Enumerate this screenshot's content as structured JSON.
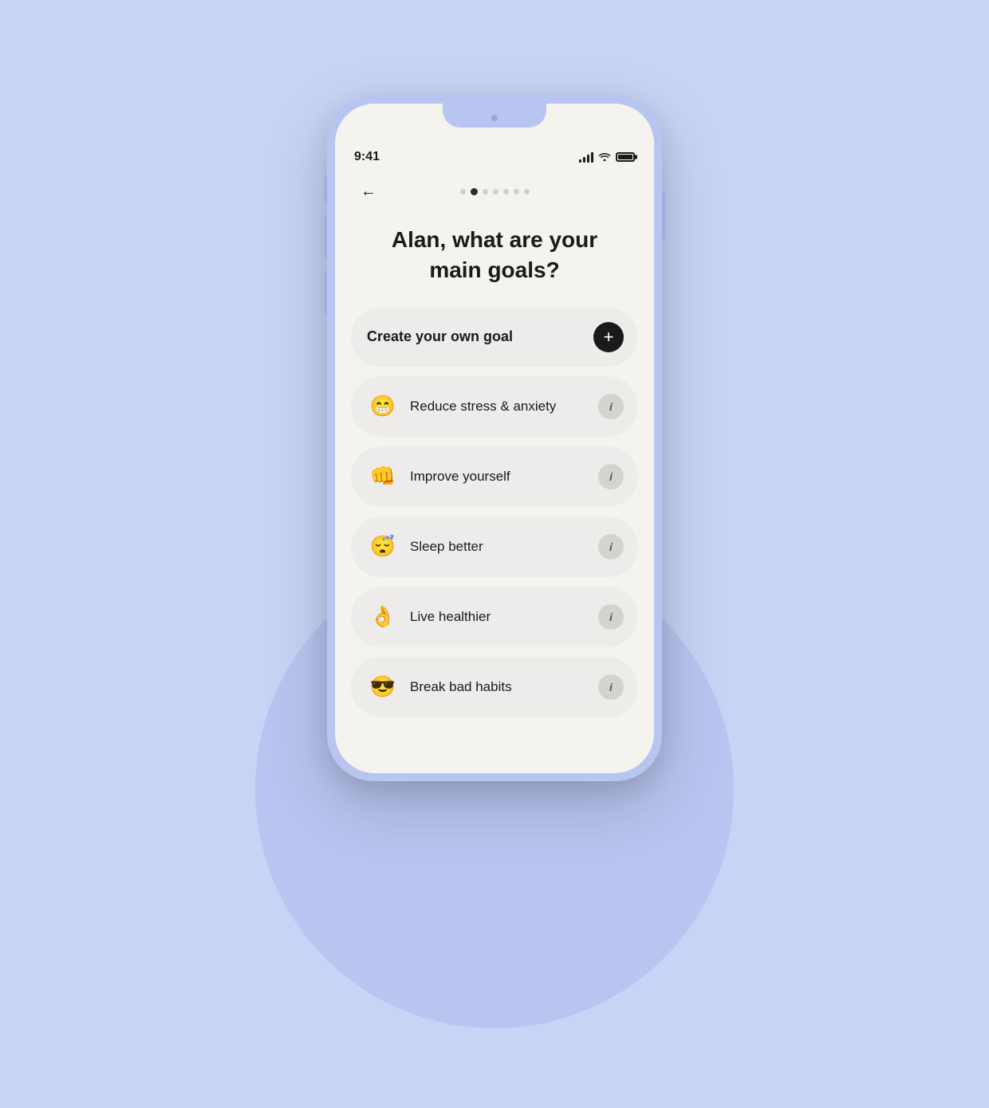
{
  "background": {
    "color": "#c8d3f5"
  },
  "statusBar": {
    "time": "9:41",
    "batteryFull": true
  },
  "navigation": {
    "backLabel": "←",
    "dots": [
      {
        "id": 1,
        "active": false
      },
      {
        "id": 2,
        "active": true
      },
      {
        "id": 3,
        "active": false
      },
      {
        "id": 4,
        "active": false
      },
      {
        "id": 5,
        "active": false
      },
      {
        "id": 6,
        "active": false
      },
      {
        "id": 7,
        "active": false
      }
    ]
  },
  "page": {
    "title": "Alan, what are your\nmain goals?"
  },
  "goals": [
    {
      "id": "create-own",
      "label": "Create your own goal",
      "emoji": null,
      "action": "add",
      "bold": true
    },
    {
      "id": "reduce-stress",
      "label": "Reduce stress & anxiety",
      "emoji": "😁",
      "action": "info"
    },
    {
      "id": "improve-yourself",
      "label": "Improve yourself",
      "emoji": "👊",
      "action": "info"
    },
    {
      "id": "sleep-better",
      "label": "Sleep better",
      "emoji": "😴",
      "action": "info"
    },
    {
      "id": "live-healthier",
      "label": "Live healthier",
      "emoji": "👌",
      "action": "info"
    },
    {
      "id": "break-bad-habits",
      "label": "Break bad habits",
      "emoji": "😎",
      "action": "info"
    }
  ],
  "infoButtonLabel": "i",
  "addButtonLabel": "+"
}
